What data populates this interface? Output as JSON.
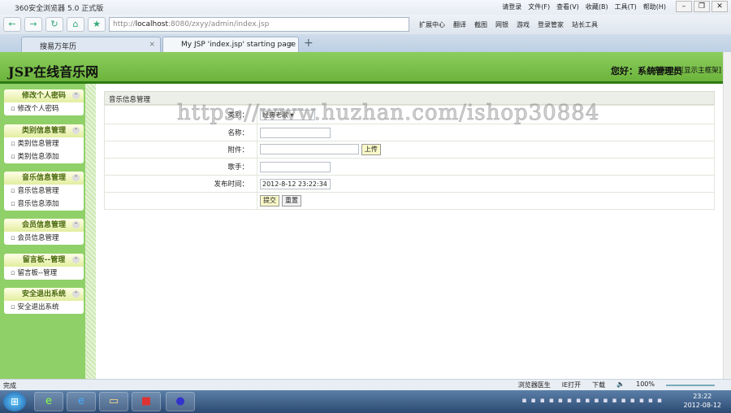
{
  "browser": {
    "title": "360安全浏览器 5.0 正式版",
    "menus": [
      "请登录",
      "文件(F)",
      "查看(V)",
      "收藏(B)",
      "工具(T)",
      "帮助(H)"
    ],
    "url_prefix": "http://",
    "url_host": "localhost",
    "url_rest": ":8080/zxyy/admin/index.jsp",
    "toolbar": [
      "扩展中心",
      "翻译",
      "截图",
      "网银",
      "游戏",
      "登录管家",
      "站长工具"
    ],
    "tabs": [
      {
        "label": "搜易万年历"
      },
      {
        "label": "My JSP 'index.jsp' starting page"
      }
    ]
  },
  "header": {
    "logo": "JSP在线音乐网",
    "greeting": "您好：系统管理员",
    "logout": "[注销退出]",
    "show_frame": "[显示主框架]"
  },
  "sidebar": [
    {
      "title": "修改个人密码",
      "items": [
        "修改个人密码"
      ]
    },
    {
      "title": "类别信息管理",
      "items": [
        "类别信息管理",
        "类别信息添加"
      ]
    },
    {
      "title": "音乐信息管理",
      "items": [
        "音乐信息管理",
        "音乐信息添加"
      ]
    },
    {
      "title": "会员信息管理",
      "items": [
        "会员信息管理"
      ]
    },
    {
      "title": "留言板--管理",
      "items": [
        "留言板--管理"
      ]
    },
    {
      "title": "安全退出系统",
      "items": [
        "安全退出系统"
      ]
    }
  ],
  "form": {
    "title": "音乐信息管理",
    "category_label": "类别：",
    "category_value": "经典老歌",
    "name_label": "名称：",
    "name_value": "",
    "attach_label": "附件：",
    "attach_value": "",
    "upload_button": "上传",
    "singer_label": "歌手：",
    "singer_value": "",
    "time_label": "发布时间：",
    "time_value": "2012-8-12 23:22:34",
    "submit": "提交",
    "reset": "重置"
  },
  "watermark": "https://www.huzhan.com/ishop30884",
  "status": {
    "text": "完成",
    "doctor": "浏览器医生",
    "ie_open": "IE打开",
    "download": "下载",
    "zoom": "100%"
  },
  "taskbar": {
    "time": "23:22",
    "date": "2012-08-12"
  }
}
